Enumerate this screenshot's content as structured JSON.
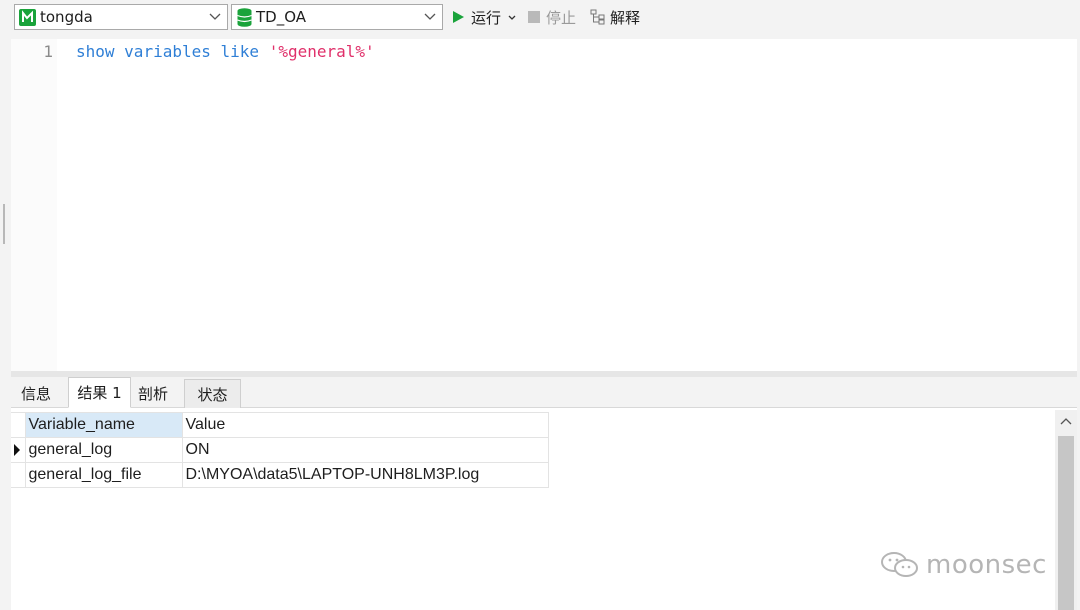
{
  "toolbar": {
    "connection": {
      "label": "tongda",
      "icon": "connection-icon"
    },
    "database": {
      "label": "TD_OA",
      "icon": "database-icon"
    },
    "run_label": "运行",
    "stop_label": "停止",
    "explain_label": "解释"
  },
  "editor": {
    "line_number": "1",
    "code": {
      "k1": "show",
      "k2": "variables",
      "k3": "like",
      "literal": "'%general%'"
    }
  },
  "tabs": [
    {
      "label": "信息"
    },
    {
      "label": "结果 1"
    },
    {
      "label": "剖析"
    },
    {
      "label": "状态"
    }
  ],
  "grid": {
    "columns": [
      "Variable_name",
      "Value"
    ],
    "rows": [
      [
        "general_log",
        "ON"
      ],
      [
        "general_log_file",
        "D:\\MYOA\\data5\\LAPTOP-UNH8LM3P.log"
      ]
    ]
  },
  "watermark": "moonsec",
  "colors": {
    "keyword": "#2f7fd6",
    "string": "#e0306a",
    "selected_header": "#d8e9f7",
    "run_green": "#1aa33b",
    "db_green": "#1aa33b"
  }
}
